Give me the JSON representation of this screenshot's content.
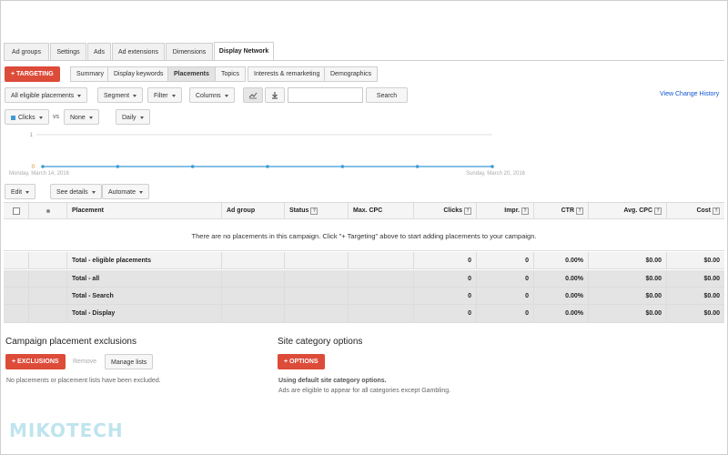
{
  "tabs": [
    "Ad groups",
    "Settings",
    "Ads",
    "Ad extensions",
    "Dimensions",
    "Display Network"
  ],
  "targeting_button": "TARGETING",
  "subtabs": [
    "Summary",
    "Display keywords",
    "Placements",
    "Topics",
    "Interests & remarketing",
    "Demographics"
  ],
  "toolbar": {
    "all_eligible": "All eligible placements",
    "segment": "Segment",
    "filter": "Filter",
    "columns": "Columns",
    "search_label": "Search",
    "search_value": "",
    "view_change_history": "View Change History"
  },
  "chart_controls": {
    "metric1": "Clicks",
    "vs": "vs",
    "metric2": "None",
    "period": "Daily"
  },
  "chart": {
    "y_top": "1",
    "y_bottom": "0",
    "start_date": "Monday, March 14, 2016",
    "end_date": "Sunday, March 20, 2016",
    "line_color": "#3f9ad6"
  },
  "chart_data": {
    "type": "line",
    "x": [
      "Mar 14",
      "Mar 15",
      "Mar 16",
      "Mar 17",
      "Mar 18",
      "Mar 19",
      "Mar 20"
    ],
    "series": [
      {
        "name": "Clicks",
        "values": [
          0,
          0,
          0,
          0,
          0,
          0,
          0
        ]
      }
    ],
    "ylim": [
      0,
      1
    ]
  },
  "actions": {
    "edit": "Edit",
    "see_details": "See details",
    "automate": "Automate"
  },
  "table": {
    "headers": [
      "Placement",
      "Ad group",
      "Status",
      "Max. CPC",
      "Clicks",
      "Impr.",
      "CTR",
      "Avg. CPC",
      "Cost"
    ],
    "empty_message": "There are no placements in this campaign. Click \"+ Targeting\" above to start adding placements to your campaign.",
    "totals": [
      {
        "label": "Total - eligible placements",
        "clicks": "0",
        "impr": "0",
        "ctr": "0.00%",
        "avg_cpc": "$0.00",
        "cost": "$0.00"
      },
      {
        "label": "Total - all",
        "clicks": "0",
        "impr": "0",
        "ctr": "0.00%",
        "avg_cpc": "$0.00",
        "cost": "$0.00"
      },
      {
        "label": "Total - Search",
        "clicks": "0",
        "impr": "0",
        "ctr": "0.00%",
        "avg_cpc": "$0.00",
        "cost": "$0.00"
      },
      {
        "label": "Total - Display",
        "clicks": "0",
        "impr": "0",
        "ctr": "0.00%",
        "avg_cpc": "$0.00",
        "cost": "$0.00"
      }
    ]
  },
  "exclusions": {
    "title": "Campaign placement exclusions",
    "button": "EXCLUSIONS",
    "remove": "Remove",
    "manage": "Manage lists",
    "note": "No placements or placement lists have been excluded."
  },
  "site_category": {
    "title": "Site category options",
    "button": "OPTIONS",
    "line1": "Using default site category options.",
    "line2": "Ads are eligible to appear for all categories except Gambling."
  },
  "watermark": "MIKOTECH"
}
